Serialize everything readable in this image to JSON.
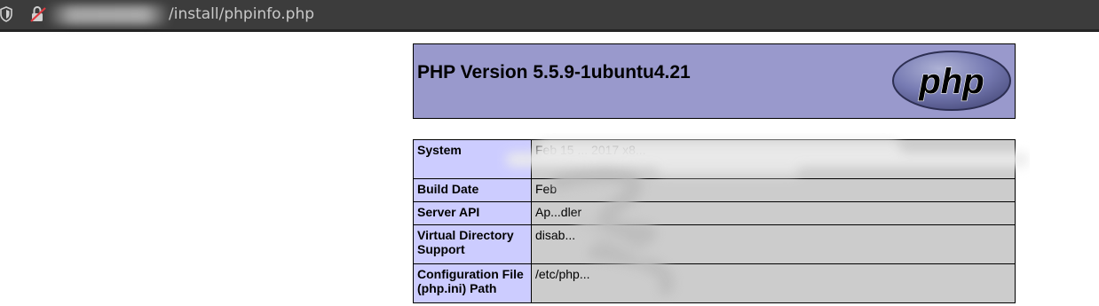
{
  "browser": {
    "url_path": "/install/phpinfo.php"
  },
  "phpinfo": {
    "title": "PHP Version 5.5.9-1ubuntu4.21",
    "logo_text": "php",
    "rows": [
      {
        "label": "System",
        "value": "Feb 15 ... 2017 x8..."
      },
      {
        "label": "Build Date",
        "value": "Feb"
      },
      {
        "label": "Server API",
        "value": "Ap...dler"
      },
      {
        "label": "Virtual Directory Support",
        "value": "disab..."
      },
      {
        "label": "Configuration File (php.ini) Path",
        "value": "/etc/php..."
      }
    ]
  },
  "colors": {
    "header_bg": "#9999cc",
    "label_bg": "#ccccff",
    "value_bg": "#cccccc",
    "urlbar_bg": "#3c3c3c"
  }
}
